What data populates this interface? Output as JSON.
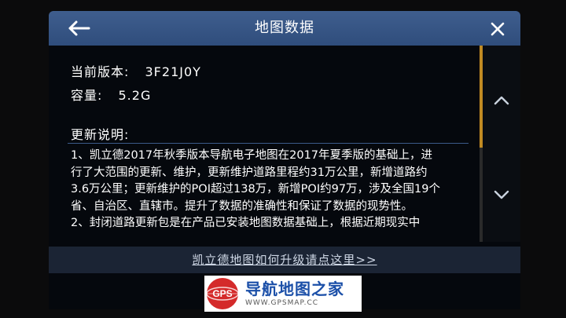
{
  "header": {
    "title": "地图数据"
  },
  "info": {
    "version_label": "当前版本:",
    "version_value": "3F21J0Y",
    "size_label": "容量:",
    "size_value": "5.2G"
  },
  "notes": {
    "heading": "更新说明:",
    "lines": [
      "1、凯立德2017年秋季版本导航电子地图在2017年夏季版的基础上，进",
      "行了大范围的更新、维护，更新维护道路里程约31万公里，新增道路约",
      "3.6万公里；更新维护的POI超过138万，新增POI约97万，涉及全国19个",
      "省、自治区、直辖市。提升了数据的准确性和保证了数据的现势性。",
      "2、封闭道路更新包是在产品已安装地图数据基础上，根据近期现实中"
    ]
  },
  "footer": {
    "upgrade_link": "凯立德地图如何升级请点这里>>"
  },
  "watermark": {
    "logo_text": "GPS",
    "name": "导航地图之家",
    "url": "WWW.GPSMAP.CC"
  },
  "icons": {
    "back": "back-arrow-icon",
    "close": "close-icon",
    "scroll_up": "chevron-up-icon",
    "scroll_down": "chevron-down-icon"
  },
  "colors": {
    "titlebar": "#3a5889",
    "scroll_thumb": "#c08a22",
    "watermark_blue": "#1b4fa8",
    "watermark_red": "#d42a2a"
  }
}
